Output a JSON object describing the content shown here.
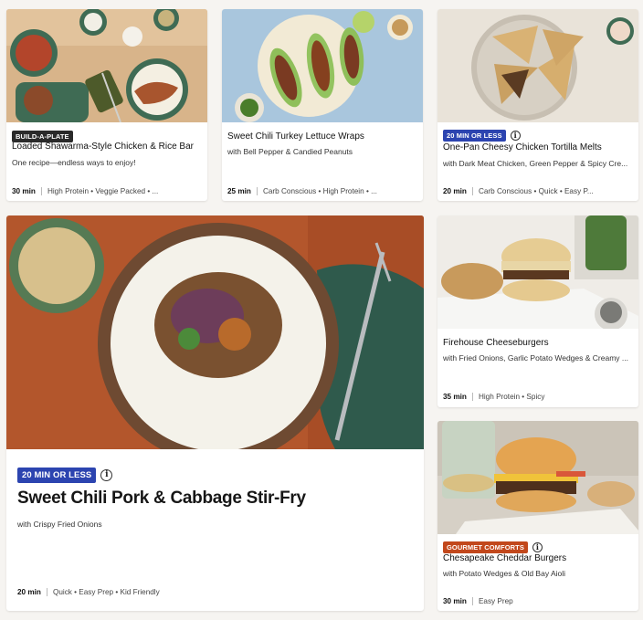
{
  "cards": [
    {
      "title": "Loaded Shawarma-Style Chicken & Rice Bar",
      "subtitle": "One recipe—endless ways to enjoy!",
      "badge": "BUILD-A-PLATE",
      "time": "30 min",
      "tags": "High Protein • Veggie Packed • ..."
    },
    {
      "title": "Sweet Chili Turkey Lettuce Wraps",
      "subtitle": "with Bell Pepper & Candied Peanuts",
      "time": "25 min",
      "tags": "Carb Conscious • High Protein • ..."
    },
    {
      "title": "One-Pan Cheesy Chicken Tortilla Melts",
      "subtitle": "with Dark Meat Chicken, Green Pepper & Spicy Cre...",
      "badge": "20 MIN OR LESS",
      "time": "20 min",
      "tags": "Carb Conscious • Quick • Easy P..."
    },
    {
      "title": "Sweet Chili Pork & Cabbage Stir-Fry",
      "subtitle": "with Crispy Fried Onions",
      "badge": "20 MIN OR LESS",
      "time": "20 min",
      "tags": "Quick • Easy Prep • Kid Friendly"
    },
    {
      "title": "Firehouse Cheeseburgers",
      "subtitle": "with Fried Onions, Garlic Potato Wedges & Creamy ...",
      "time": "35 min",
      "tags": "High Protein • Spicy"
    },
    {
      "title": "Chesapeake Cheddar Burgers",
      "subtitle": "with Potato Wedges & Old Bay Aioli",
      "badge": "GOURMET COMFORTS",
      "time": "30 min",
      "tags": "Easy Prep"
    }
  ],
  "info_icon_glyph": "i"
}
